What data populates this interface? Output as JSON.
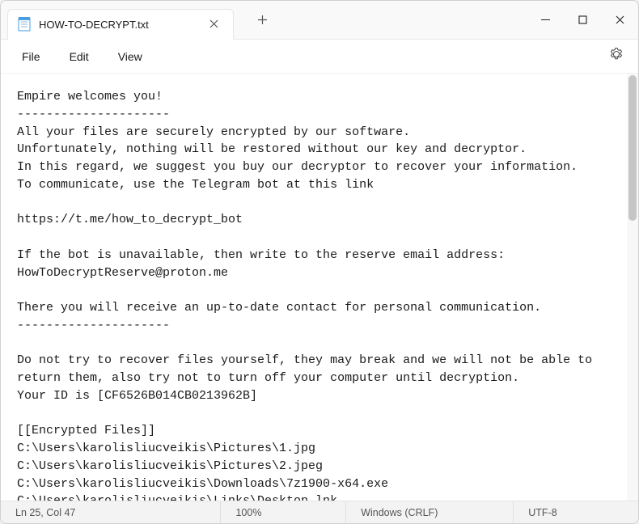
{
  "titlebar": {
    "tab_title": "HOW-TO-DECRYPT.txt"
  },
  "menubar": {
    "file": "File",
    "edit": "Edit",
    "view": "View"
  },
  "editor": {
    "content": "Empire welcomes you!\n---------------------\nAll your files are securely encrypted by our software.\nUnfortunately, nothing will be restored without our key and decryptor.\nIn this regard, we suggest you buy our decryptor to recover your information.\nTo communicate, use the Telegram bot at this link\n\nhttps://t.me/how_to_decrypt_bot\n\nIf the bot is unavailable, then write to the reserve email address: HowToDecryptReserve@proton.me\n\nThere you will receive an up-to-date contact for personal communication.\n---------------------\n\nDo not try to recover files yourself, they may break and we will not be able to return them, also try not to turn off your computer until decryption.\nYour ID is [CF6526B014CB0213962B]\n\n[[Encrypted Files]]\nC:\\Users\\karolisliucveikis\\Pictures\\1.jpg\nC:\\Users\\karolisliucveikis\\Pictures\\2.jpeg\nC:\\Users\\karolisliucveikis\\Downloads\\7z1900-x64.exe\nC:\\Users\\karolisliucveikis\\Links\\Desktop.lnk"
  },
  "statusbar": {
    "cursor": "Ln 25, Col 47",
    "zoom": "100%",
    "eol": "Windows (CRLF)",
    "encoding": "UTF-8"
  }
}
